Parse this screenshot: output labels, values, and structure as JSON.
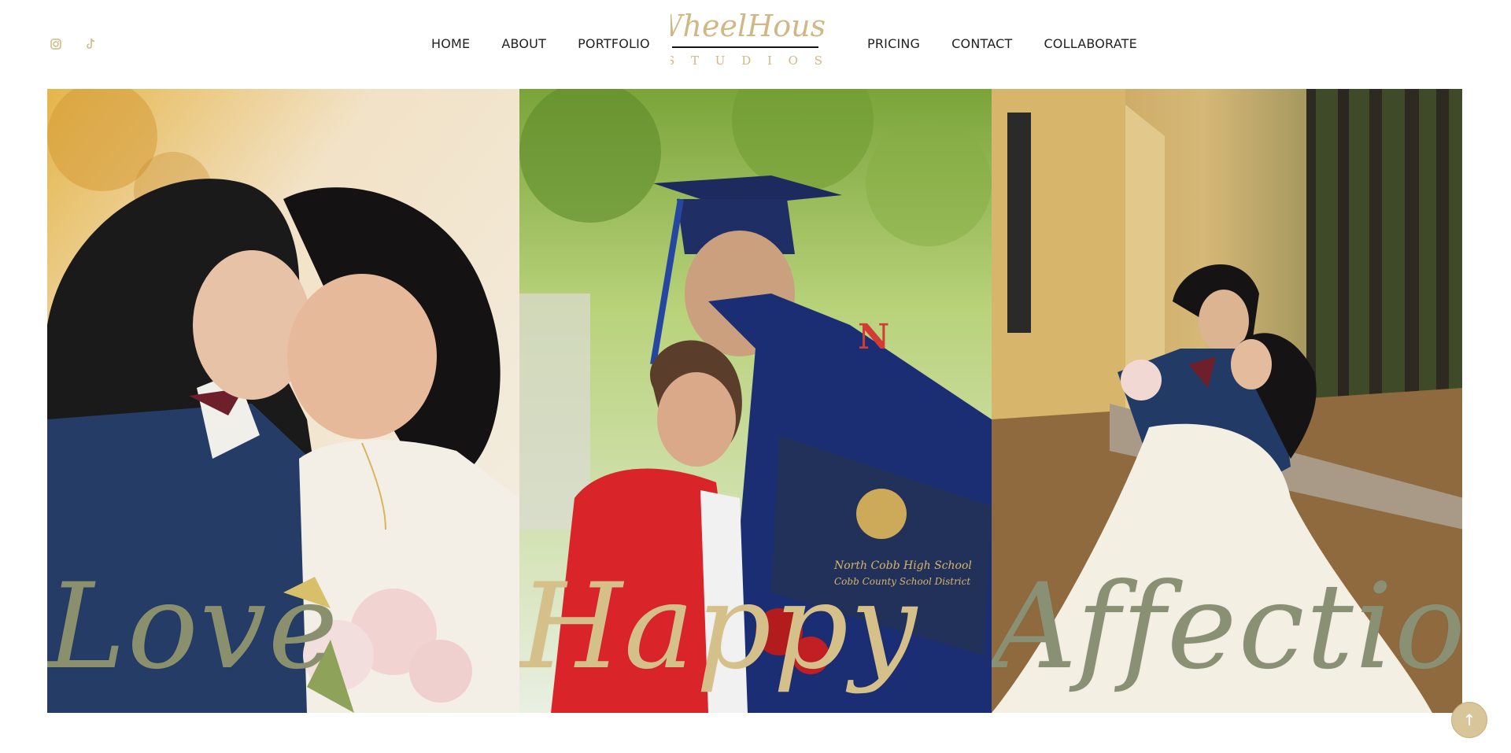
{
  "social": [
    {
      "icon": "instagram-icon"
    },
    {
      "icon": "tiktok-icon"
    }
  ],
  "nav_left": [
    "HOME",
    "ABOUT",
    "PORTFOLIO"
  ],
  "nav_right": [
    "PRICING",
    "CONTACT",
    "COLLABORATE"
  ],
  "logo": {
    "line1": "WheelHouse",
    "line2": "S T U D I O S"
  },
  "panels": [
    {
      "word": "Love",
      "word_color": "#8a8f6e"
    },
    {
      "word": "Happy",
      "word_color": "#d6c08a"
    },
    {
      "word": "Affection",
      "word_color": "#8a9074"
    }
  ],
  "back_to_top": "↑",
  "colors": {
    "accent": "#d1b784",
    "text": "#1f1f1f"
  }
}
